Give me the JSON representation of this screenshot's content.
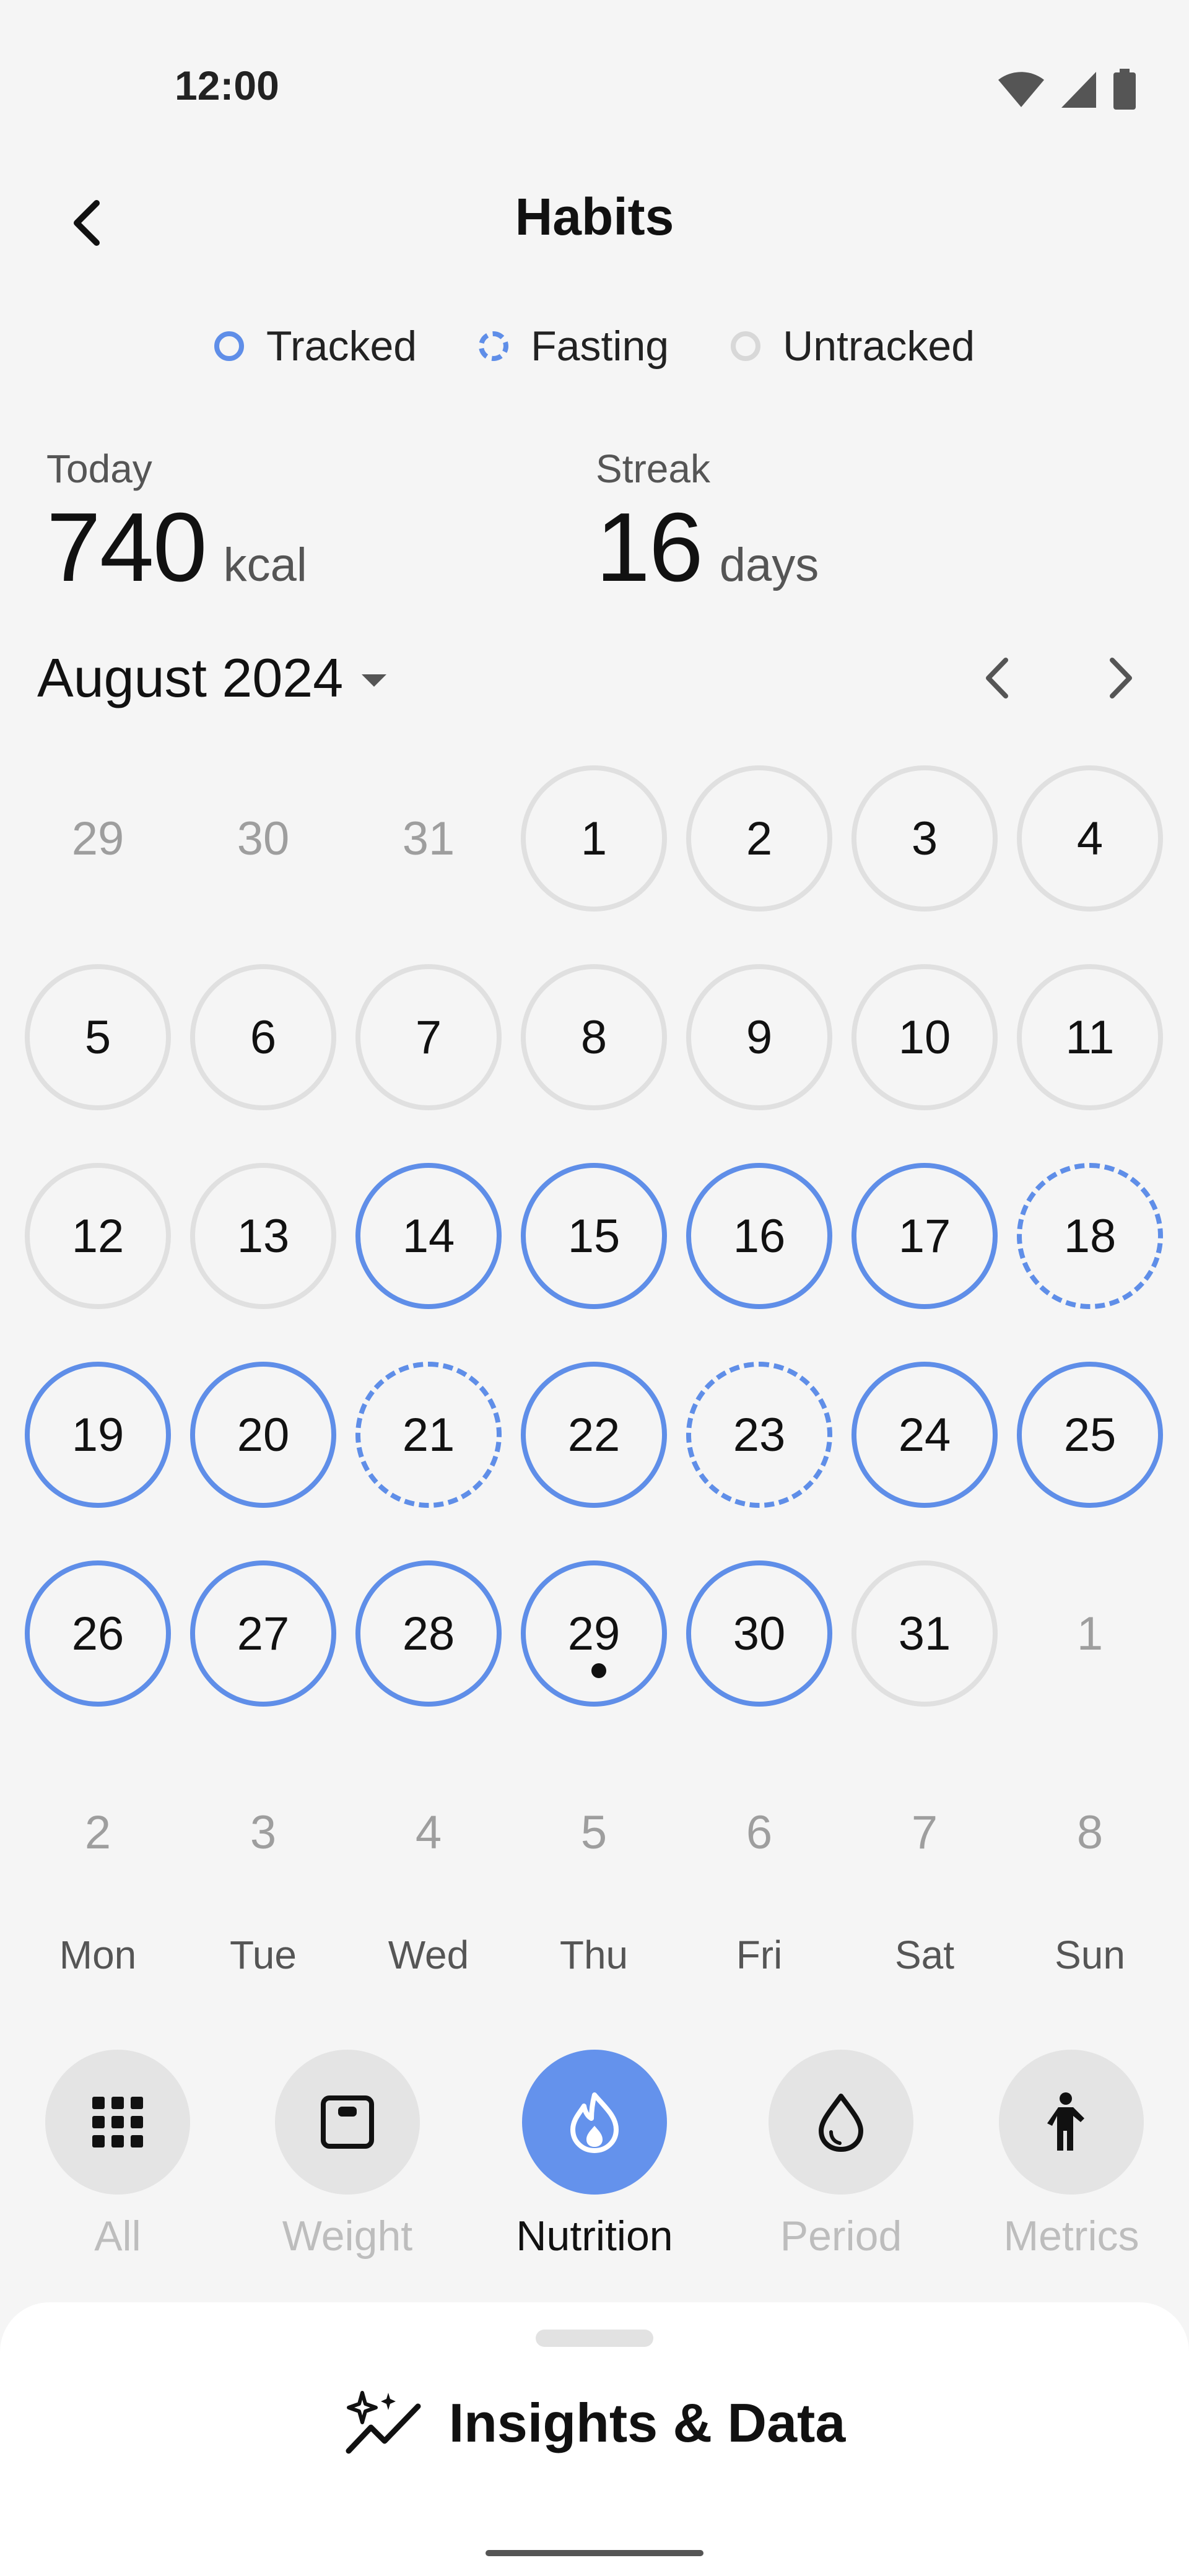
{
  "status_bar": {
    "time": "12:00",
    "icons": [
      "wifi-icon",
      "signal-icon",
      "battery-icon"
    ]
  },
  "header": {
    "title": "Habits",
    "back_icon": "back-arrow-icon"
  },
  "legend": [
    {
      "label": "Tracked",
      "style": "tracked"
    },
    {
      "label": "Fasting",
      "style": "fasting"
    },
    {
      "label": "Untracked",
      "style": "untracked"
    }
  ],
  "stats": {
    "today": {
      "label": "Today",
      "value": "740",
      "unit": "kcal"
    },
    "streak": {
      "label": "Streak",
      "value": "16",
      "unit": "days"
    }
  },
  "calendar": {
    "month_label": "August 2024",
    "weeks": [
      [
        {
          "d": "29",
          "s": "outside"
        },
        {
          "d": "30",
          "s": "outside"
        },
        {
          "d": "31",
          "s": "outside"
        },
        {
          "d": "1",
          "s": "untracked"
        },
        {
          "d": "2",
          "s": "untracked"
        },
        {
          "d": "3",
          "s": "untracked"
        },
        {
          "d": "4",
          "s": "untracked"
        }
      ],
      [
        {
          "d": "5",
          "s": "untracked"
        },
        {
          "d": "6",
          "s": "untracked"
        },
        {
          "d": "7",
          "s": "untracked"
        },
        {
          "d": "8",
          "s": "untracked"
        },
        {
          "d": "9",
          "s": "untracked"
        },
        {
          "d": "10",
          "s": "untracked"
        },
        {
          "d": "11",
          "s": "untracked"
        }
      ],
      [
        {
          "d": "12",
          "s": "untracked"
        },
        {
          "d": "13",
          "s": "untracked"
        },
        {
          "d": "14",
          "s": "tracked"
        },
        {
          "d": "15",
          "s": "tracked"
        },
        {
          "d": "16",
          "s": "tracked"
        },
        {
          "d": "17",
          "s": "tracked"
        },
        {
          "d": "18",
          "s": "fasting"
        }
      ],
      [
        {
          "d": "19",
          "s": "tracked"
        },
        {
          "d": "20",
          "s": "tracked"
        },
        {
          "d": "21",
          "s": "fasting"
        },
        {
          "d": "22",
          "s": "tracked"
        },
        {
          "d": "23",
          "s": "fasting"
        },
        {
          "d": "24",
          "s": "tracked"
        },
        {
          "d": "25",
          "s": "tracked"
        }
      ],
      [
        {
          "d": "26",
          "s": "tracked"
        },
        {
          "d": "27",
          "s": "tracked"
        },
        {
          "d": "28",
          "s": "tracked"
        },
        {
          "d": "29",
          "s": "tracked",
          "today": true
        },
        {
          "d": "30",
          "s": "tracked"
        },
        {
          "d": "31",
          "s": "untracked"
        },
        {
          "d": "1",
          "s": "outside"
        }
      ],
      [
        {
          "d": "2",
          "s": "outside"
        },
        {
          "d": "3",
          "s": "outside"
        },
        {
          "d": "4",
          "s": "outside"
        },
        {
          "d": "5",
          "s": "outside"
        },
        {
          "d": "6",
          "s": "outside"
        },
        {
          "d": "7",
          "s": "outside"
        },
        {
          "d": "8",
          "s": "outside"
        }
      ]
    ],
    "weekdays": [
      "Mon",
      "Tue",
      "Wed",
      "Thu",
      "Fri",
      "Sat",
      "Sun"
    ]
  },
  "categories": [
    {
      "label": "All",
      "icon": "grid-icon",
      "active": false
    },
    {
      "label": "Weight",
      "icon": "scale-icon",
      "active": false
    },
    {
      "label": "Nutrition",
      "icon": "flame-icon",
      "active": true
    },
    {
      "label": "Period",
      "icon": "droplet-icon",
      "active": false
    },
    {
      "label": "Metrics",
      "icon": "person-icon",
      "active": false
    }
  ],
  "sheet": {
    "title": "Insights & Data",
    "icon": "sparkle-chart-icon"
  },
  "colors": {
    "accent": "#5f8ee8",
    "untracked": "#e0e0e0",
    "background": "#f5f5f5"
  }
}
